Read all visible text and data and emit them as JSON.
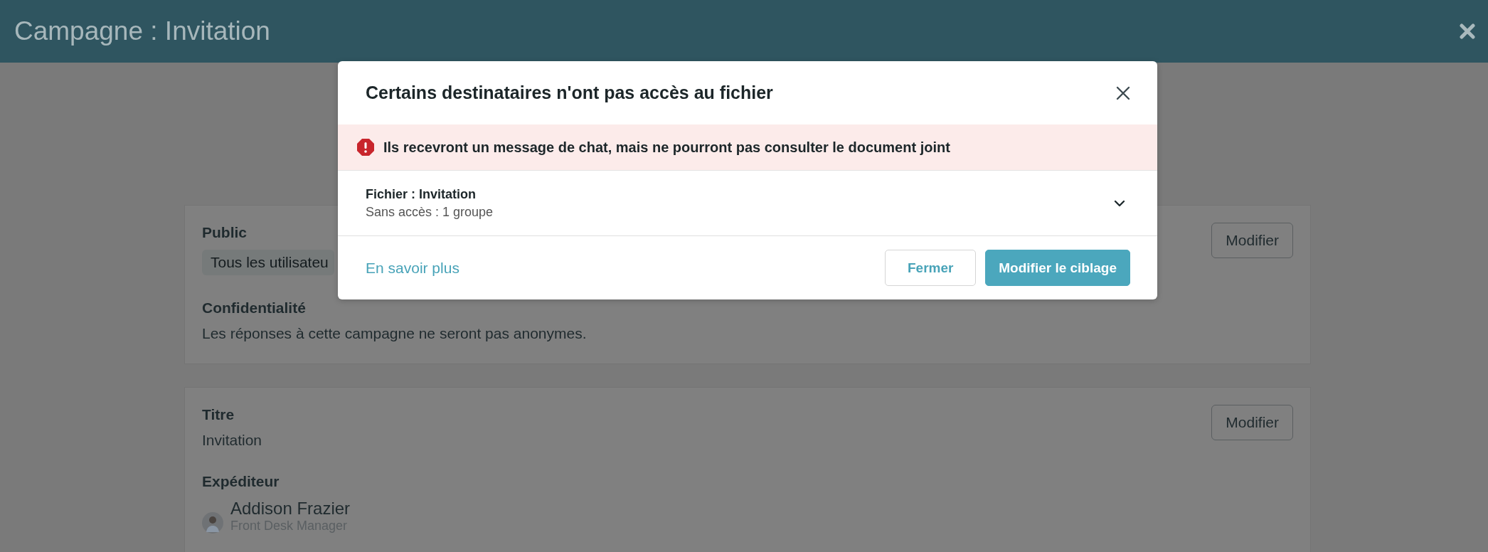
{
  "header": {
    "title": "Campagne : Invitation"
  },
  "cards": [
    {
      "button": "Modifier",
      "sections": [
        {
          "label": "Public",
          "kind": "chip",
          "value": "Tous les utilisateu"
        },
        {
          "label": "Confidentialité",
          "kind": "text",
          "value": "Les réponses à cette campagne ne seront pas anonymes."
        }
      ]
    },
    {
      "button": "Modifier",
      "sections": [
        {
          "label": "Titre",
          "kind": "text",
          "value": "Invitation"
        },
        {
          "label": "Expéditeur",
          "kind": "person",
          "name": "Addison Frazier",
          "role": "Front Desk Manager"
        }
      ]
    }
  ],
  "modal": {
    "title": "Certains destinataires n'ont pas accès au fichier",
    "alert": "Ils recevront un message de chat, mais ne pourront pas consulter le document joint",
    "file": {
      "name": "Fichier : Invitation",
      "detail": "Sans accès : 1 groupe",
      "expanded": false
    },
    "link": "En savoir plus",
    "buttons": [
      {
        "label": "Fermer",
        "kind": "secondary"
      },
      {
        "label": "Modifier le ciblage",
        "kind": "primary"
      }
    ]
  }
}
